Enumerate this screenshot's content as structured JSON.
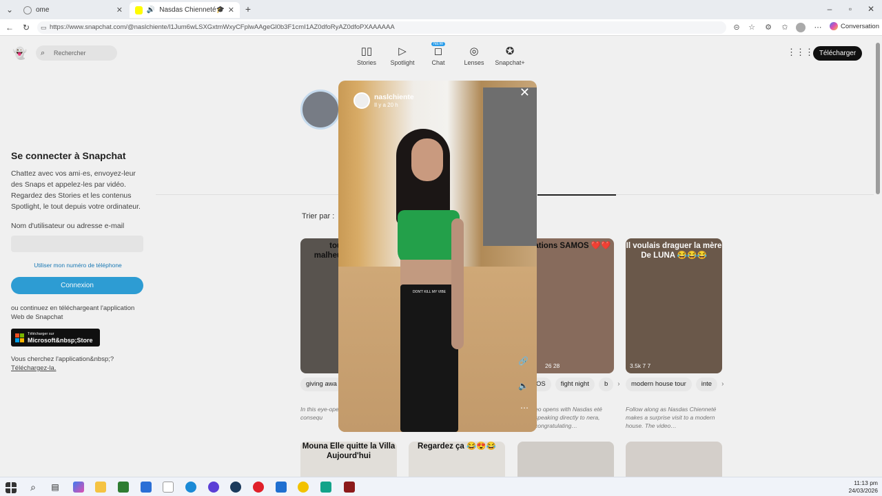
{
  "browser": {
    "tabs": [
      {
        "label": "ome",
        "close": "✕"
      },
      {
        "label": "Nasdas Chienneté🎓 (@nasl",
        "close": "✕"
      }
    ],
    "new_tab": "+",
    "url": "https://www.snapchat.com/@naslchiente/l1Jum6wLSXGxtmWxyCFplwAAgeGl0b3F1cmI1AZ0dfoRyAZ0dfoPXAAAAAA",
    "conversation_label": "Conversation"
  },
  "snap": {
    "search_placeholder": "Rechercher",
    "nav": [
      {
        "label": "Stories",
        "icon": "stories-icon"
      },
      {
        "label": "Spotlight",
        "icon": "spotlight-icon"
      },
      {
        "label": "Chat",
        "icon": "chat-icon"
      },
      {
        "label": "Lenses",
        "icon": "lenses-icon"
      },
      {
        "label": "Snapchat+",
        "icon": "snapchat-plus-icon"
      }
    ],
    "chat_badge": "NEW",
    "download_label": "Télécharger"
  },
  "login": {
    "title": "Se connecter à Snapchat",
    "description": "Chattez avec vos ami·es, envoyez-leur des Snaps et appelez-les par vidéo. Regardez des Stories et les contenus Spotlight, le tout depuis votre ordinateur.",
    "username_label": "Nom d'utilisateur ou adresse e-mail",
    "phone_link": "Utiliser mon numéro de téléphone",
    "login_button": "Connexion",
    "alt_text": "ou continuez en téléchargeant l'application Web de Snapchat",
    "store_small": "Télécharger sur",
    "store_big": "Microsoft&nbsp;Store",
    "looking_text": "Vous cherchez l'application&nbsp;?",
    "download_link": "Téléchargez-la."
  },
  "profile": {
    "sort_label": "Trier par :"
  },
  "cards": [
    {
      "caption": "tou malheu",
      "stats": ""
    },
    {
      "caption": "licitations SAMOS ❤️❤️",
      "stats": "26   28"
    },
    {
      "caption": "Il voulais draguer la mère De LUNA 😂😂😂",
      "stats": "3.5k   7   7"
    }
  ],
  "chips": {
    "left": [
      "giving awa"
    ],
    "mid": [
      "OS",
      "fight night",
      "b"
    ],
    "right": [
      "modern house tour",
      "inte"
    ]
  },
  "descriptions": [
    "In this eye-ope experiment, th the consequ",
    "eo opens with Nasdas eté speaking directly to nera, congratulating…",
    "Follow along as Nasdas Chienneté makes a surprise visit to a modern house. The video…"
  ],
  "row2_captions": [
    "Mouna Elle quitte la Villa Aujourd'hui",
    "Regardez ça 😂😍😂",
    "",
    ""
  ],
  "modal": {
    "username": "naslchiente",
    "time": "Il y a 20 h",
    "shirt_text": "DON'T KILL MY VIBE"
  },
  "taskbar": {
    "time": "11:13 pm",
    "date": "24/03/2026"
  }
}
